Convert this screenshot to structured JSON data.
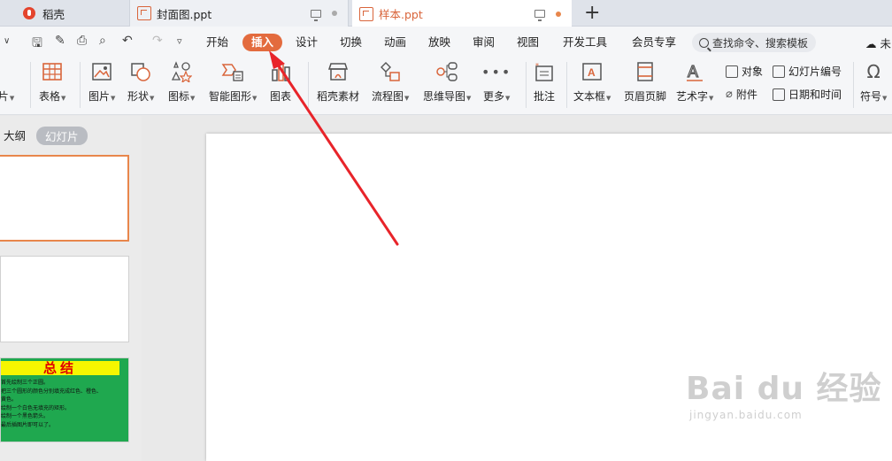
{
  "tabs": [
    {
      "label": "稻壳"
    },
    {
      "label": "封面图.ppt"
    },
    {
      "label": "样本.ppt"
    }
  ],
  "menu": {
    "items": [
      "开始",
      "插入",
      "设计",
      "切换",
      "动画",
      "放映",
      "审阅",
      "视图",
      "开发工具",
      "会员专享"
    ],
    "active": "插入",
    "search_placeholder": "查找命令、搜索模板",
    "cloud_label": "未"
  },
  "ribbon": {
    "partial_left": "片",
    "table": "表格",
    "picture": "图片",
    "shape": "形状",
    "icon": "图标",
    "smartart": "智能图形",
    "chart": "图表",
    "docer": "稻壳素材",
    "flowchart": "流程图",
    "mindmap": "思维导图",
    "more": "更多",
    "comment": "批注",
    "textbox": "文本框",
    "header_footer": "页眉页脚",
    "wordart": "艺术字",
    "object": "对象",
    "attachment": "附件",
    "slide_number": "幻灯片编号",
    "datetime": "日期和时间",
    "symbol": "符号"
  },
  "leftpanel": {
    "outline_tab": "大纲",
    "slides_tab": "幻灯片",
    "summary": {
      "title": "总结",
      "lines": [
        "首先绘制三个正圆。",
        "把三个圆形的颜色分别填充成红色、橙色、",
        "黄色。",
        "绘制一个白色无填充的矩形。",
        "绘制一个黑色箭头。",
        "最后插图片即可以了。"
      ]
    }
  },
  "watermark": {
    "main": "Bai du 经验",
    "sub": "jingyan.baidu.com"
  },
  "colors": {
    "accent": "#e36b3e",
    "arrow": "#e8242a",
    "summary_bg": "#1fa84f",
    "summary_title_bg": "#f6f600",
    "summary_title_fg": "#e00000"
  }
}
